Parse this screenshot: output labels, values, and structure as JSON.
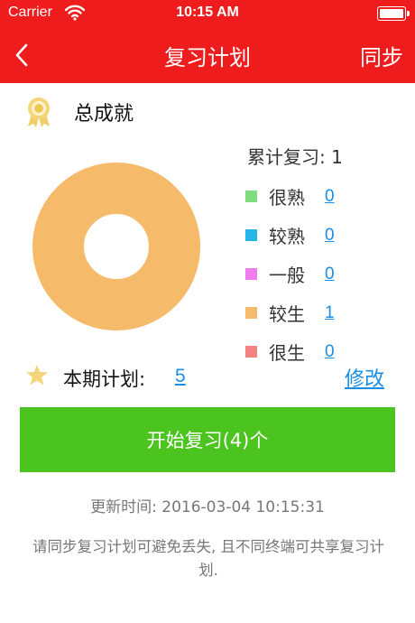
{
  "status_bar": {
    "carrier": "Carrier",
    "time": "10:15 AM"
  },
  "nav": {
    "title": "复习计划",
    "sync_label": "同步"
  },
  "achievement": {
    "title": "总成就",
    "total_label": "累计复习: 1"
  },
  "legend": [
    {
      "label": "很熟",
      "count": "0",
      "color": "#7fdc7f"
    },
    {
      "label": "较熟",
      "count": "0",
      "color": "#27b4e6"
    },
    {
      "label": "一般",
      "count": "0",
      "color": "#f17cf0"
    },
    {
      "label": "较生",
      "count": "1",
      "color": "#f5bb6b"
    },
    {
      "label": "很生",
      "count": "0",
      "color": "#f48282"
    }
  ],
  "plan": {
    "label": "本期计划:",
    "count": "5",
    "edit_label": "修改"
  },
  "start_button": {
    "label": "开始复习(4)个"
  },
  "footer": {
    "update_text": "更新时间: 2016-03-04 10:15:31",
    "note": "请同步复习计划可避免丢失, 且不同终端可共享复习计划."
  },
  "colors": {
    "brand": "#ee1c1c",
    "primary_action": "#4cc41f",
    "link": "#1a8ee6"
  }
}
